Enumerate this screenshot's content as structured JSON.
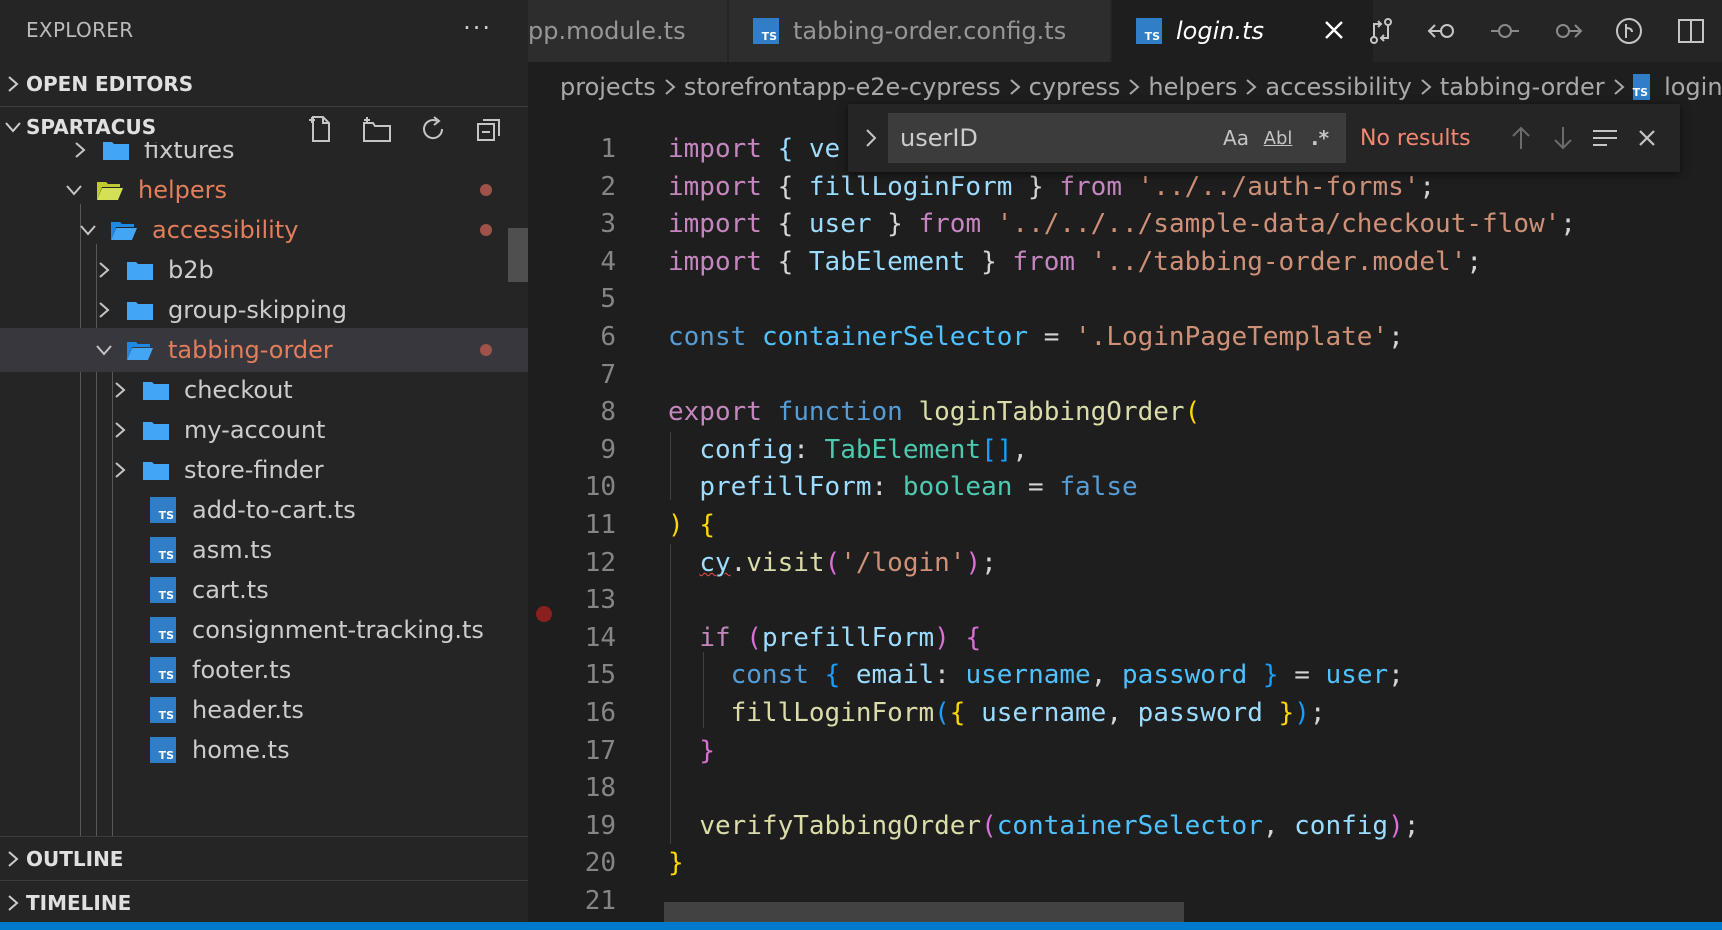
{
  "explorer": {
    "title": "EXPLORER",
    "more_label": "···",
    "sections": {
      "open_editors": "OPEN EDITORS",
      "workspace": "SPARTACUS",
      "outline": "OUTLINE",
      "timeline": "TIMELINE"
    },
    "tree": [
      {
        "label": "fixtures"
      },
      {
        "label": "helpers"
      },
      {
        "label": "accessibility"
      },
      {
        "label": "b2b"
      },
      {
        "label": "group-skipping"
      },
      {
        "label": "tabbing-order"
      },
      {
        "label": "checkout"
      },
      {
        "label": "my-account"
      },
      {
        "label": "store-finder"
      },
      {
        "label": "add-to-cart.ts"
      },
      {
        "label": "asm.ts"
      },
      {
        "label": "cart.ts"
      },
      {
        "label": "consignment-tracking.ts"
      },
      {
        "label": "footer.ts"
      },
      {
        "label": "header.ts"
      },
      {
        "label": "home.ts"
      }
    ]
  },
  "tabs": [
    {
      "label": "pp.module.ts"
    },
    {
      "label": "tabbing-order.config.ts"
    },
    {
      "label": "login.ts"
    }
  ],
  "ts_badge": "TS",
  "breadcrumbs": [
    "projects",
    "storefrontapp-e2e-cypress",
    "cypress",
    "helpers",
    "accessibility",
    "tabbing-order",
    "login.ts"
  ],
  "find": {
    "query": "userID",
    "match_case": "Aa",
    "whole_word": "Abl",
    "regex": ".*",
    "result": "No results"
  },
  "editor": {
    "line_numbers": [
      "1",
      "2",
      "3",
      "4",
      "5",
      "6",
      "7",
      "8",
      "9",
      "10",
      "11",
      "12",
      "13",
      "14",
      "15",
      "16",
      "17",
      "18",
      "19",
      "20",
      "21"
    ],
    "code": {
      "l1a": "import",
      "l1b": " { ve",
      "l2a": "import",
      "l2b": "fillLoginForm",
      "l2c": "from",
      "l2d": "'../../auth-forms'",
      "l3a": "import",
      "l3b": "user",
      "l3c": "from",
      "l3d": "'../../../sample-data/checkout-flow'",
      "l4a": "import",
      "l4b": "TabElement",
      "l4c": "from",
      "l4d": "'../tabbing-order.model'",
      "l6a": "const",
      "l6b": "containerSelector",
      "l6c": "'.LoginPageTemplate'",
      "l8a": "export",
      "l8b": "function",
      "l8c": "loginTabbingOrder",
      "l9a": "config",
      "l9b": "TabElement",
      "l10a": "prefillForm",
      "l10b": "boolean",
      "l10c": "false",
      "l12a": "cy",
      "l12b": "visit",
      "l12c": "'/login'",
      "l14a": "if",
      "l14b": "prefillForm",
      "l15a": "const",
      "l15b": "email",
      "l15c": "username",
      "l15d": "password",
      "l15e": "user",
      "l16a": "fillLoginForm",
      "l16b": "username",
      "l16c": "password",
      "l19a": "verifyTabbingOrder",
      "l19b": "containerSelector",
      "l19c": "config"
    }
  },
  "colors": {
    "accent": "#007acc",
    "modified": "#e37e5b",
    "find_no_results": "#f48771"
  },
  "icons": [
    "chevron-right-icon",
    "chevron-down-icon",
    "folder-icon",
    "folder-open-icon",
    "new-file-icon",
    "new-folder-icon",
    "refresh-icon",
    "collapse-all-icon",
    "close-icon",
    "compare-icon",
    "go-back-icon",
    "git-commit-icon",
    "go-forward-icon",
    "git-graph-icon",
    "split-editor-icon",
    "arrow-up-icon",
    "arrow-down-icon",
    "find-in-selection-icon"
  ]
}
